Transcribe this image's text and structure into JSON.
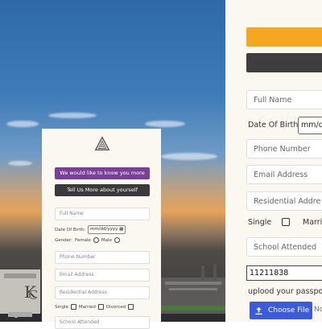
{
  "left_card": {
    "btn_know_you": "We would like to know you more",
    "btn_tell_us": "Tell Us More about yourself",
    "full_name_ph": "Full Name",
    "dob_label": "Date Of Birth:",
    "dob_value": "mm/dd/yyyy",
    "gender_label": "Gender:",
    "female_label": "Female",
    "male_label": "Male",
    "phone_ph": "Phone Number",
    "email_ph": "Email Address",
    "residential_ph": "Residential Address",
    "single_label": "Single",
    "married_label": "Married",
    "divorced_label": "Divorced",
    "school_ph": "School Attended"
  },
  "right_panel": {
    "full_name_ph": "Full Name",
    "dob_label": "Date Of Birth:",
    "dob_value": "mm/d",
    "phone_ph": "Phone Number",
    "email_ph": "Email Address",
    "residential_ph": "Residential Addre",
    "single_label": "Single",
    "married_label": "Marri",
    "school_ph": "School Attended",
    "number_value": "11211838",
    "passport_label": "uplood your passpo",
    "choose_file_label": "Choose File",
    "file_after": "No"
  },
  "colors": {
    "purple": "#7b3f98",
    "dark": "#3a3a3a",
    "yellow": "#f4a822",
    "blue": "#3b5bdb"
  }
}
